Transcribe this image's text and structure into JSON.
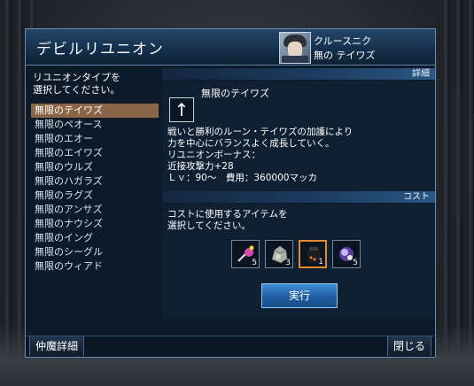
{
  "window": {
    "title": "デビルリユニオン",
    "character": {
      "name": "クルースニク",
      "type": "無の テイワズ"
    }
  },
  "left": {
    "header_line1": "リユニオンタイプを",
    "header_line2": "選択してください。",
    "items": [
      {
        "label": "無限のテイワズ",
        "selected": true
      },
      {
        "label": "無限のペオース",
        "selected": false
      },
      {
        "label": "無限のエオー",
        "selected": false
      },
      {
        "label": "無限のエイワズ",
        "selected": false
      },
      {
        "label": "無限のウルズ",
        "selected": false
      },
      {
        "label": "無限のハガラズ",
        "selected": false
      },
      {
        "label": "無限のラグズ",
        "selected": false
      },
      {
        "label": "無限のアンサズ",
        "selected": false
      },
      {
        "label": "無限のナウシズ",
        "selected": false
      },
      {
        "label": "無限のイング",
        "selected": false
      },
      {
        "label": "無限のシーグル",
        "selected": false
      },
      {
        "label": "無限のウィアド",
        "selected": false
      }
    ]
  },
  "detail": {
    "section_label": "詳細",
    "type_name": "無限のテイワズ",
    "icon": "up-arrow-icon",
    "desc_line1": "戦いと勝利のルーン・テイワズの加護により",
    "desc_line2": "力を中心にバランスよく成長していく。",
    "bonus_title": "リユニオンボーナス：",
    "bonus_value": "近接攻撃力+28",
    "level_cost": "Ｌｖ：90～　費用：360000マッカ"
  },
  "cost": {
    "section_label": "コスト",
    "desc_line1": "コストに使用するアイテムを",
    "desc_line2": "選択してください。",
    "items": [
      {
        "icon": "pink-staff-item-icon",
        "qty": "5"
      },
      {
        "icon": "grey-stone-item-icon",
        "qty": "3"
      },
      {
        "icon": "black-pouch-item-icon",
        "qty": "1"
      },
      {
        "icon": "purple-orb-item-icon",
        "qty": "5"
      }
    ]
  },
  "buttons": {
    "execute": "実行",
    "companion_detail": "仲魔詳細",
    "close": "閉じる"
  },
  "colors": {
    "accent": "#1f5d9f",
    "selected_row": "#8a6547",
    "selected_item_border": "#e08a2c"
  }
}
